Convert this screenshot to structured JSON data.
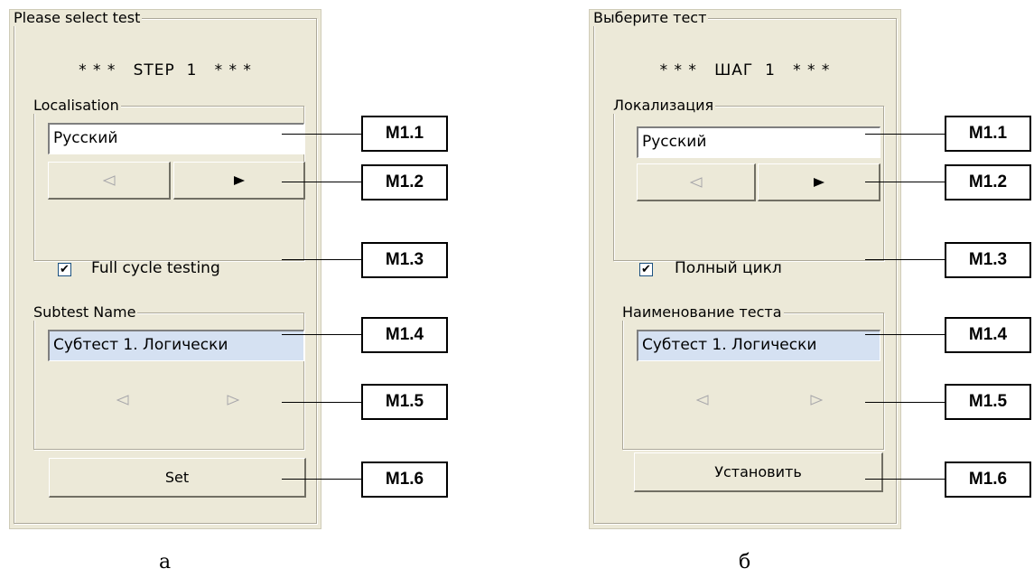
{
  "left": {
    "title": "Please select test",
    "step": "* * *   STEP  1   * * *",
    "localisation_label": "Localisation",
    "language_value": "Русский",
    "full_cycle_label": "Full cycle testing",
    "full_cycle_checked": true,
    "subtest_label": "Subtest Name",
    "subtest_value": "Субтест 1. Логически",
    "set_button": "Set",
    "caption": "а"
  },
  "right": {
    "title": "Выберите тест",
    "step": "* * *   ШАГ  1   * * *",
    "localisation_label": "Локализация",
    "language_value": "Русский",
    "full_cycle_label": "Полный цикл",
    "full_cycle_checked": true,
    "subtest_label": "Наименование теста",
    "subtest_value": "Субтест 1. Логически",
    "set_button": "Установить",
    "caption": "б"
  },
  "markers": [
    "M1.1",
    "M1.2",
    "M1.3",
    "M1.4",
    "M1.5",
    "M1.6"
  ],
  "icons": {
    "prev_disabled": "triangle-left-outline",
    "next_enabled": "triangle-right-filled",
    "next_disabled": "triangle-right-outline",
    "check": "check-mark"
  }
}
